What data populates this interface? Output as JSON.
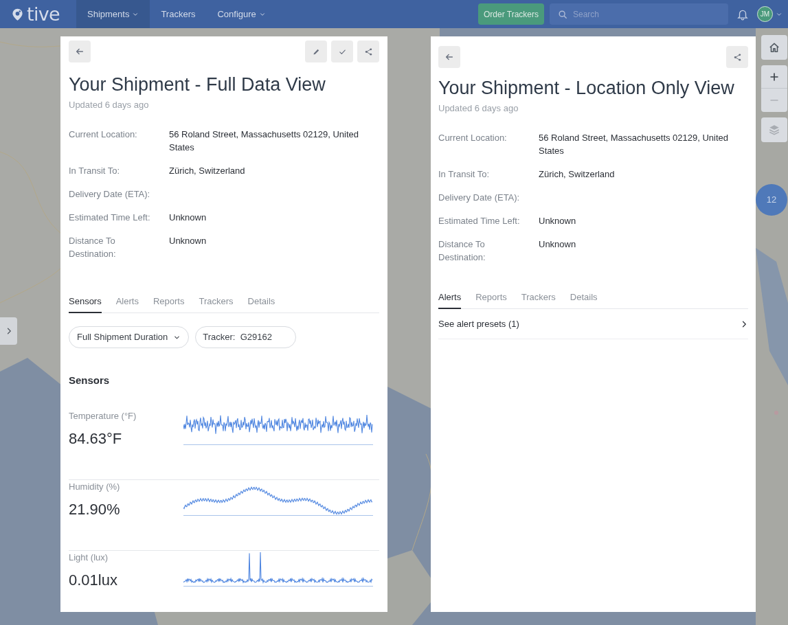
{
  "nav": {
    "logo": "tive",
    "items": [
      {
        "label": "Shipments",
        "selected": true,
        "dropdown": true
      },
      {
        "label": "Trackers",
        "selected": false,
        "dropdown": false
      },
      {
        "label": "Configure",
        "selected": false,
        "dropdown": true
      }
    ],
    "order_button": "Order Trackers",
    "search": {
      "placeholder": "Search"
    },
    "avatar": "JM"
  },
  "map": {
    "cluster_count": "12"
  },
  "panels": [
    {
      "title": "Your Shipment - Full Data View",
      "updated": "Updated 6 days ago",
      "actions": [
        {
          "kind": "edit"
        },
        {
          "kind": "confirm"
        },
        {
          "kind": "share"
        }
      ],
      "fields": [
        {
          "label": "Current Location:",
          "value": "56 Roland Street, Massachusetts 02129, United States"
        },
        {
          "label": "In Transit To:",
          "value": "Zürich, Switzerland"
        },
        {
          "label": "Delivery Date (ETA):"
        },
        {
          "label": "Estimated Time Left:",
          "value": "Unknown"
        },
        {
          "label": "Distance To Destination:",
          "value": "Unknown"
        }
      ],
      "tabs": [
        {
          "label": "Sensors",
          "selected": true
        },
        {
          "label": "Alerts",
          "selected": false
        },
        {
          "label": "Reports",
          "selected": false
        },
        {
          "label": "Trackers",
          "selected": false
        },
        {
          "label": "Details",
          "selected": false
        }
      ],
      "duration_select": "Full Shipment Duration",
      "tracker_field": "Tracker:  G29162",
      "sensors_heading": "Sensors",
      "sensors": [
        {
          "label": "Temperature (°F)",
          "value": "84.63°F"
        },
        {
          "label": "Humidity (%)",
          "value": "21.90%"
        },
        {
          "label": "Light (lux)",
          "value": "0.01lux"
        }
      ]
    },
    {
      "title": "Your Shipment - Location Only View",
      "updated": "Updated 6 days ago",
      "actions": [
        {
          "kind": "share"
        }
      ],
      "fields": [
        {
          "label": "Current Location:",
          "value": "56 Roland Street, Massachusetts 02129, United States"
        },
        {
          "label": "In Transit To:",
          "value": "Zürich, Switzerland"
        },
        {
          "label": "Delivery Date (ETA):"
        },
        {
          "label": "Estimated Time Left:",
          "value": "Unknown"
        },
        {
          "label": "Distance To Destination:",
          "value": "Unknown"
        }
      ],
      "tabs": [
        {
          "label": "Alerts",
          "selected": true
        },
        {
          "label": "Reports",
          "selected": false
        },
        {
          "label": "Trackers",
          "selected": false
        },
        {
          "label": "Details",
          "selected": false
        }
      ],
      "alert_presets": "See alert presets (1)"
    }
  ]
}
